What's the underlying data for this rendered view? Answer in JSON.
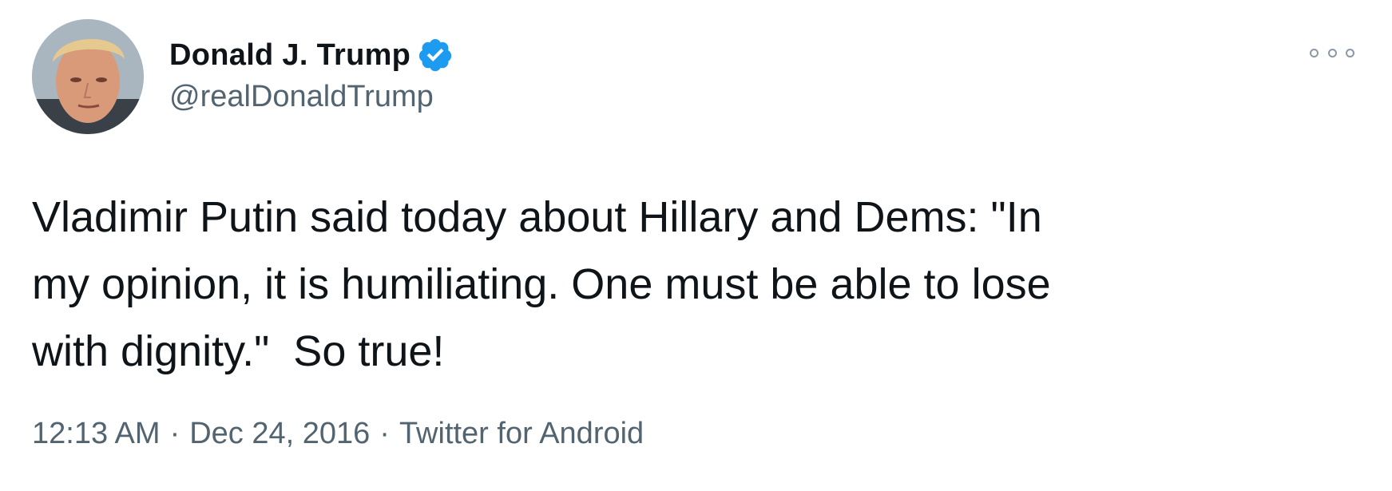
{
  "author": {
    "display_name": "Donald J. Trump",
    "handle": "@realDonaldTrump",
    "verified": true,
    "verified_color": "#1d9bf0"
  },
  "tweet": {
    "text": "Vladimir Putin said today about Hillary and Dems: \"In\nmy opinion, it is humiliating. One must be able to lose\nwith dignity.\"  So true!",
    "time": "12:13 AM",
    "date": "Dec 24, 2016",
    "source": "Twitter for Android",
    "separator": "·"
  },
  "icons": {
    "more": "more-options-icon",
    "verified": "verified-badge-icon",
    "avatar": "profile-avatar"
  },
  "colors": {
    "text_primary": "#0f1419",
    "text_secondary": "#536471",
    "background": "#ffffff"
  }
}
